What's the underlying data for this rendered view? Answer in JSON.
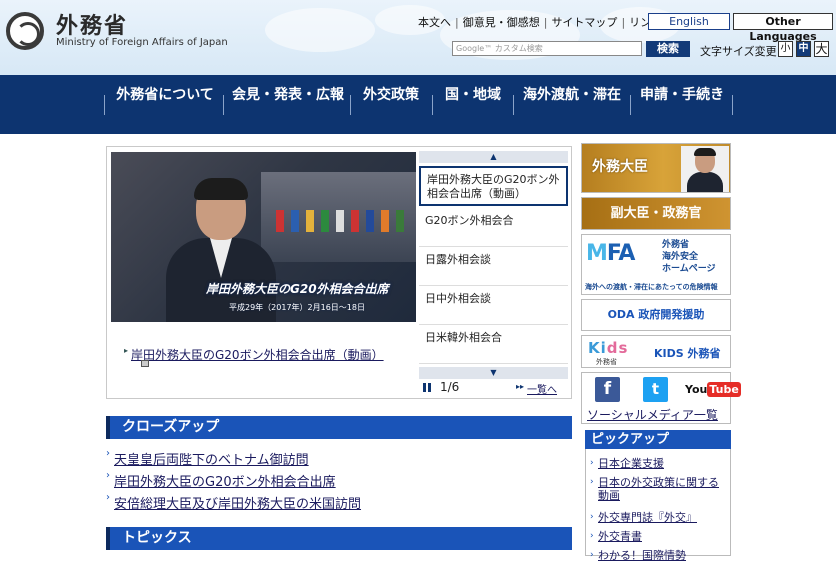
{
  "header": {
    "logo_jp": "外務省",
    "logo_en": "Ministry of Foreign Affairs of Japan",
    "util_links": [
      "本文へ",
      "御意見・御感想",
      "サイトマップ",
      "リンク集"
    ],
    "english_label": "English",
    "other_languages_label": "Other Languages",
    "search_placeholder": "Google™ カスタム検索",
    "search_button": "検索",
    "font_size_label": "文字サイズ変更",
    "font_sizes": [
      "小",
      "中",
      "大"
    ]
  },
  "nav": {
    "items": [
      "外務省について",
      "会見・発表・広報",
      "外交政策",
      "国・地域",
      "海外渡航・滞在",
      "申請・手続き"
    ]
  },
  "slider": {
    "hero_caption": "岸田外務大臣のG20外相会合出席",
    "hero_subcaption": "平成29年（2017年）2月16日〜18日",
    "main_link": "岸田外務大臣のG20ボン外相会合出席（動画）",
    "thumbs": [
      "岸田外務大臣のG20ボン外相会合出席（動画）",
      "G20ボン外相会合",
      "日露外相会談",
      "日中外相会談",
      "日米韓外相会合"
    ],
    "counter": "1/6",
    "list_link": "一覧へ"
  },
  "closeup": {
    "title": "クローズアップ",
    "items": [
      "天皇皇后両陛下のベトナム御訪問",
      "岸田外務大臣のG20ボン外相会合出席",
      "安倍総理大臣及び岸田外務大臣の米国訪問"
    ]
  },
  "topics": {
    "title": "トピックス"
  },
  "sidebar": {
    "minister": "外務大臣",
    "vice": "副大臣・政務官",
    "mofa_logo_a": "M",
    "mofa_logo_b": "FA",
    "mofa_lines": [
      "外務省",
      "海外安全",
      "ホームページ"
    ],
    "mofa_caption": "海外への渡航・滞在にあたっての危険情報",
    "oda": "ODA 政府開発援助",
    "kids_logo_a": "Ki",
    "kids_logo_b": "ds",
    "kids_sub": "外務省",
    "kids_text": "KIDS 外務省",
    "social_fb": "f",
    "social_tw": "t",
    "social_yt_a": "You",
    "social_yt_b": "Tube",
    "social_link": "ソーシャルメディア一覧",
    "pickup_title": "ピックアップ",
    "pickup_items": [
      "日本企業支援",
      "日本の外交政策に関する動画",
      "外交専門誌『外交』",
      "外交青書",
      "わかる！国際情勢"
    ]
  }
}
